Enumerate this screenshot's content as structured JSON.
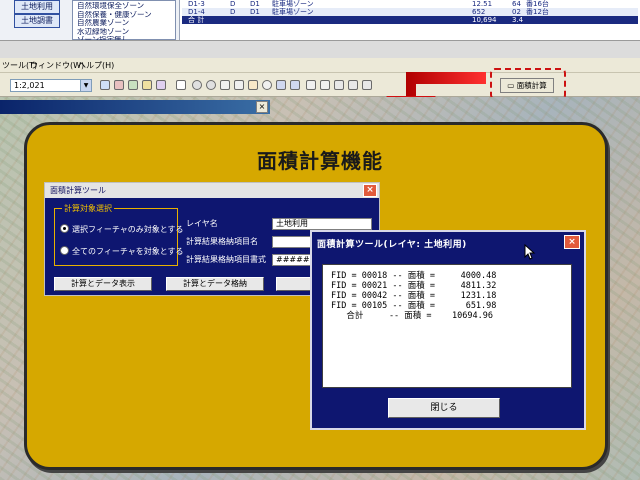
{
  "app": {
    "side_buttons": [
      "土地利用",
      "土地調書"
    ],
    "zone_list": [
      "自然環境保全ゾーン",
      "自然保養・健康ゾーン",
      "自然農業ゾーン",
      "水辺緑地ゾーン",
      "ゾーン指定無し"
    ],
    "table_rows": [
      {
        "id": "D1-3",
        "c1": "D",
        "c2": "D1",
        "c3": "駐車場ゾーン",
        "v1": "12.51",
        "v2": "64",
        "v3": "番16台"
      },
      {
        "id": "D1-4",
        "c1": "D",
        "c2": "D1",
        "c3": "駐車場ゾーン",
        "v1": "652",
        "v2": "02",
        "v3": "番12台"
      },
      {
        "id": "合 計",
        "c1": "",
        "c2": "",
        "c3": "",
        "v1": "10,694",
        "v2": "3.4",
        "v3": ""
      }
    ],
    "menu": {
      "item1": "ツール(T)",
      "item2": "ウィンドウ(W)",
      "item3": "ヘルプ(H)"
    },
    "scale_value": "1:2,021",
    "calc_tool_label": "面積計算"
  },
  "panel": {
    "title": "面積計算機能"
  },
  "tool_dialog": {
    "title": "面積計算ツール",
    "group_label": "計算対象選択",
    "radio_selected_label": "選択フィーチャのみ対象とする",
    "radio_all_label": "全てのフィーチャを対象とする",
    "layer_label": "レイヤ名",
    "layer_value": "土地利用",
    "item_name_label": "計算結果格納項目名",
    "item_name_value": "",
    "format_label": "計算結果格納項目書式",
    "format_value": "#####0.00",
    "btn_show": "計算とデータ表示",
    "btn_store": "計算とデータ格納"
  },
  "result_dialog": {
    "title": "面積計算ツール(レイヤ: 土地利用)",
    "lines": [
      "FID = 00018 -- 面積 =     4000.48",
      "FID = 00021 -- 面積 =     4811.32",
      "FID = 00042 -- 面積 =     1231.18",
      "FID = 00105 -- 面積 =      651.98",
      "   合計     -- 面積 =    10694.96"
    ],
    "close_label": "閉じる"
  }
}
